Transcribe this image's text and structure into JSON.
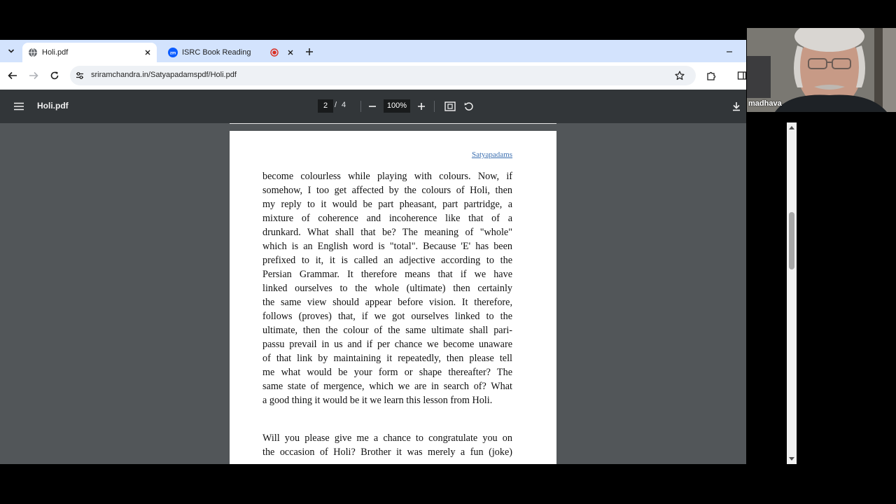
{
  "browser": {
    "tabs": [
      {
        "title": "Holi.pdf",
        "active": true,
        "icon": "globe-icon"
      },
      {
        "title": "ISRC Book Reading",
        "active": false,
        "icon": "zoom-icon",
        "recording": true
      }
    ],
    "address_bar": {
      "url": "sriramchandra.in/Satyapadamspdf/Holi.pdf"
    }
  },
  "pdf_viewer": {
    "title": "Holi.pdf",
    "current_page": "2",
    "page_separator": "/",
    "total_pages": "4",
    "zoom": "100%",
    "page": {
      "header_link": "Satyapadams",
      "paragraph1_lines": [
        "become colourless while playing with colours. Now, if",
        "somehow, I too get affected by the colours of Holi, then",
        "my reply to it would be part pheasant, part partridge, a",
        "mixture of coherence and incoherence like that of a",
        "drunkard. What shall that be? The meaning of \"whole\"",
        "which is an English word is \"total\". Because 'E' has been",
        "prefixed to it, it is called an adjective according to the",
        "Persian Grammar. It therefore means that if we have",
        "linked ourselves to the whole (ultimate) then certainly",
        "the same view should appear before vision. It therefore,",
        "follows (proves) that, if we got ourselves linked to the",
        "ultimate, then the colour of the same ultimate shall pari-",
        "passu prevail in us and if per chance we become unaware",
        "of that link by maintaining it repeatedly, then please tell",
        "me what would be your form or shape thereafter? The",
        "same state of mergence, which we are in search of? What",
        "a good thing it would be it we learn this lesson from Holi."
      ],
      "paragraph2_lines": [
        "Will you please give me a chance to congratulate you on",
        "the occasion of Holi? Brother it was merely a fun (joke)"
      ]
    }
  },
  "video_call": {
    "participant_name": "madhava"
  },
  "colors": {
    "tabstrip": "#d3e3fd",
    "pdf_toolbar": "#323639",
    "viewer_bg": "#525659",
    "link": "#3b6fb0",
    "record_red": "#d93025"
  }
}
